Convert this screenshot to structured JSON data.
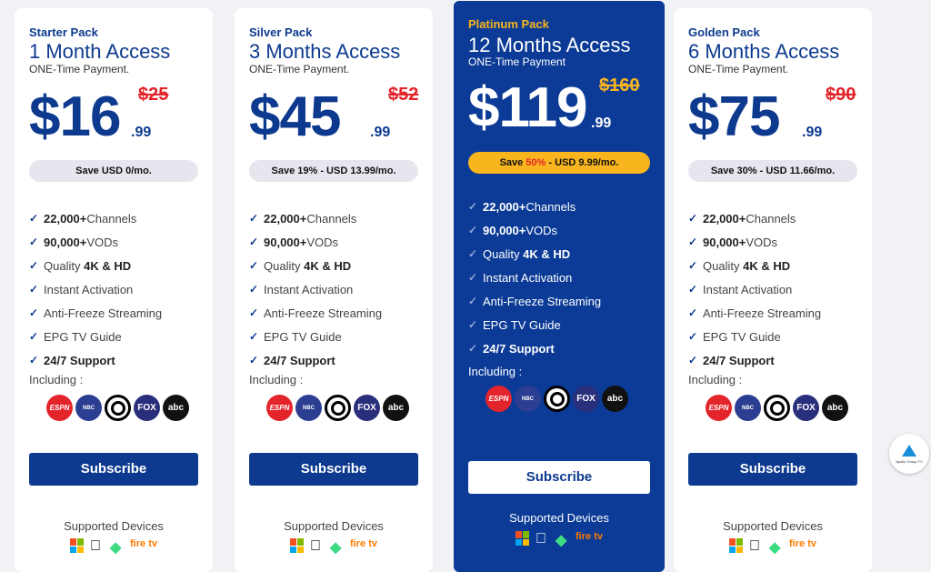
{
  "cards": [
    {
      "pack": "Starter Pack",
      "access": "1 Month Access",
      "onetime": "ONE-Time Payment.",
      "price_dollar": "$16",
      "price_cents": ".99",
      "old_price": "$25",
      "save_text": "Save USD 0/mo.",
      "features": [
        {
          "bold_prefix": "22,000+",
          "text": " Channels",
          "bold_suffix": ""
        },
        {
          "bold_prefix": "90,000+",
          "text": " VODs",
          "bold_suffix": ""
        },
        {
          "bold_prefix": "",
          "text": "Quality ",
          "bold_suffix": "4K & HD"
        },
        {
          "bold_prefix": "",
          "text": "Instant Activation",
          "bold_suffix": ""
        },
        {
          "bold_prefix": "",
          "text": "Anti-Freeze Streaming",
          "bold_suffix": ""
        },
        {
          "bold_prefix": "",
          "text": "EPG TV Guide",
          "bold_suffix": ""
        },
        {
          "bold_prefix": "24/7 Support",
          "text": "",
          "bold_suffix": ""
        }
      ],
      "including": "Including :",
      "subscribe": "Subscribe",
      "supported": "Supported Devices"
    },
    {
      "pack": "Silver Pack",
      "access": "3 Months Access",
      "onetime": "ONE-Time Payment.",
      "price_dollar": "$45",
      "price_cents": ".99",
      "old_price": "$52",
      "save_text": "Save 19% - USD 13.99/mo.",
      "features": [
        {
          "bold_prefix": "22,000+",
          "text": " Channels",
          "bold_suffix": ""
        },
        {
          "bold_prefix": "90,000+",
          "text": " VODs",
          "bold_suffix": ""
        },
        {
          "bold_prefix": "",
          "text": "Quality ",
          "bold_suffix": "4K & HD"
        },
        {
          "bold_prefix": "",
          "text": "Instant Activation",
          "bold_suffix": ""
        },
        {
          "bold_prefix": "",
          "text": "Anti-Freeze Streaming",
          "bold_suffix": ""
        },
        {
          "bold_prefix": "",
          "text": "EPG TV Guide",
          "bold_suffix": ""
        },
        {
          "bold_prefix": "24/7 Support",
          "text": "",
          "bold_suffix": ""
        }
      ],
      "including": "Including :",
      "subscribe": "Subscribe",
      "supported": "Supported Devices"
    },
    {
      "pack": "Platinum Pack",
      "access": "12 Months Access",
      "onetime": "ONE-Time Payment",
      "price_dollar": "$119",
      "price_cents": ".99",
      "old_price": "$160",
      "save_text_pre": "Save ",
      "save_text_pct": "50%",
      "save_text_post": " - USD 9.99/mo.",
      "features": [
        {
          "bold_prefix": "22,000+",
          "text": " Channels",
          "bold_suffix": ""
        },
        {
          "bold_prefix": "90,000+",
          "text": " VODs",
          "bold_suffix": ""
        },
        {
          "bold_prefix": "",
          "text": "Quality ",
          "bold_suffix": "4K & HD"
        },
        {
          "bold_prefix": "",
          "text": "Instant Activation",
          "bold_suffix": ""
        },
        {
          "bold_prefix": "",
          "text": "Anti-Freeze Streaming",
          "bold_suffix": ""
        },
        {
          "bold_prefix": "",
          "text": "EPG TV Guide",
          "bold_suffix": ""
        },
        {
          "bold_prefix": "24/7 Support",
          "text": "",
          "bold_suffix": ""
        }
      ],
      "including": "Including :",
      "subscribe": "Subscribe",
      "supported": "Supported Devices"
    },
    {
      "pack": "Golden Pack",
      "access": "6 Months Access",
      "onetime": "ONE-Time Payment.",
      "price_dollar": "$75",
      "price_cents": ".99",
      "old_price": "$90",
      "save_text": "Save 30% - USD 11.66/mo.",
      "features": [
        {
          "bold_prefix": "22,000+",
          "text": " Channels",
          "bold_suffix": ""
        },
        {
          "bold_prefix": "90,000+",
          "text": " VODs",
          "bold_suffix": ""
        },
        {
          "bold_prefix": "",
          "text": "Quality ",
          "bold_suffix": "4K & HD"
        },
        {
          "bold_prefix": "",
          "text": "Instant Activation",
          "bold_suffix": ""
        },
        {
          "bold_prefix": "",
          "text": "Anti-Freeze Streaming",
          "bold_suffix": ""
        },
        {
          "bold_prefix": "",
          "text": "EPG TV Guide",
          "bold_suffix": ""
        },
        {
          "bold_prefix": "24/7 Support",
          "text": "",
          "bold_suffix": ""
        }
      ],
      "including": "Including :",
      "subscribe": "Subscribe",
      "supported": "Supported Devices"
    }
  ],
  "channel_logos": [
    "ESPN",
    "NBC",
    "CBS",
    "FOX",
    "abc"
  ],
  "device_icons": [
    "windows-icon",
    "apple-icon",
    "android-icon",
    "firetv-icon"
  ],
  "firetv_label": "fire tv",
  "badge": {
    "text": "Apollo Group TV"
  },
  "colors": {
    "brand_blue": "#0d3a8e",
    "featured_bg": "#0b3b96",
    "gold": "#f8b51e",
    "red": "#e3242b",
    "page_bg": "#f1f2f5"
  }
}
